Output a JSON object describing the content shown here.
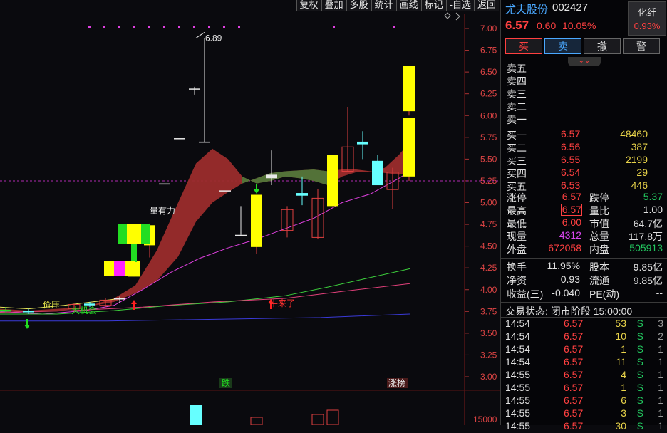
{
  "toolbar": [
    "复权",
    "叠加",
    "多股",
    "统计",
    "画线",
    "标记",
    "-自选",
    "返回"
  ],
  "stock": {
    "name": "尤夫股份",
    "code": "002427",
    "price": "6.57",
    "change": "0.60",
    "change_pct": "10.05%",
    "rz_label": "化纤",
    "rz_value": "0.93%"
  },
  "trade_buttons": [
    "买",
    "卖",
    "撤",
    "警"
  ],
  "expander": "⌄⌄",
  "order_book": {
    "asks": [
      {
        "label": "卖五",
        "price": "",
        "vol": ""
      },
      {
        "label": "卖四",
        "price": "",
        "vol": ""
      },
      {
        "label": "卖三",
        "price": "",
        "vol": ""
      },
      {
        "label": "卖二",
        "price": "",
        "vol": ""
      },
      {
        "label": "卖一",
        "price": "",
        "vol": ""
      }
    ],
    "bids": [
      {
        "label": "买一",
        "price": "6.57",
        "vol": "48460"
      },
      {
        "label": "买二",
        "price": "6.56",
        "vol": "387"
      },
      {
        "label": "买三",
        "price": "6.55",
        "vol": "2199"
      },
      {
        "label": "买四",
        "price": "6.54",
        "vol": "29"
      },
      {
        "label": "买五",
        "price": "6.53",
        "vol": "446"
      }
    ]
  },
  "stats": [
    {
      "l1": "涨停",
      "v1": "6.57",
      "c1": "#ff4040",
      "l2": "跌停",
      "v2": "5.37",
      "c2": "#22c55e"
    },
    {
      "l1": "最高",
      "v1": "6.57",
      "c1": "#ff4040",
      "l2": "量比",
      "v2": "1.00",
      "c2": "#e0e0e0"
    },
    {
      "l1": "最低",
      "v1": "6.00",
      "c1": "#ff4040",
      "l2": "市值",
      "v2": "64.7亿",
      "c2": "#e0e0e0"
    },
    {
      "l1": "现量",
      "v1": "4312",
      "c1": "#d946ef",
      "l2": "总量",
      "v2": "117.8万",
      "c2": "#e0e0e0"
    },
    {
      "l1": "外盘",
      "v1": "672058",
      "c1": "#ff4040",
      "l2": "内盘",
      "v2": "505913",
      "c2": "#22c55e"
    }
  ],
  "stats2": [
    {
      "l1": "换手",
      "v1": "11.95%",
      "l2": "股本",
      "v2": "9.85亿"
    },
    {
      "l1": "净资",
      "v1": "0.93",
      "l2": "流通",
      "v2": "9.85亿"
    },
    {
      "l1": "收益(三)",
      "v1": "-0.040",
      "l2": "PE(动)",
      "v2": "--"
    }
  ],
  "trade_status": "交易状态: 闭市阶段 15:00:00",
  "ticks": [
    {
      "time": "14:54",
      "price": "6.57",
      "vol": "53",
      "side": "S",
      "n": "3"
    },
    {
      "time": "14:54",
      "price": "6.57",
      "vol": "10",
      "side": "S",
      "n": "2"
    },
    {
      "time": "14:54",
      "price": "6.57",
      "vol": "1",
      "side": "S",
      "n": "1"
    },
    {
      "time": "14:54",
      "price": "6.57",
      "vol": "11",
      "side": "S",
      "n": "1"
    },
    {
      "time": "14:55",
      "price": "6.57",
      "vol": "4",
      "side": "S",
      "n": "1"
    },
    {
      "time": "14:55",
      "price": "6.57",
      "vol": "1",
      "side": "S",
      "n": "1"
    },
    {
      "time": "14:55",
      "price": "6.57",
      "vol": "6",
      "side": "S",
      "n": "1"
    },
    {
      "time": "14:55",
      "price": "6.57",
      "vol": "3",
      "side": "S",
      "n": "1"
    },
    {
      "time": "14:55",
      "price": "6.57",
      "vol": "30",
      "side": "S",
      "n": "1"
    }
  ],
  "chart_data": {
    "type": "candlestick",
    "y_ticks": [
      "7.00",
      "6.75",
      "6.50",
      "6.25",
      "6.00",
      "5.75",
      "5.50",
      "5.25",
      "5.00",
      "4.75",
      "4.50",
      "4.25",
      "4.00",
      "3.75",
      "3.50",
      "3.25",
      "3.00"
    ],
    "y_tick_values": [
      7.0,
      6.75,
      6.5,
      6.25,
      6.0,
      5.75,
      5.5,
      5.25,
      5.0,
      4.75,
      4.5,
      4.25,
      4.0,
      3.75,
      3.5,
      3.25,
      3.0
    ],
    "ylim": [
      2.95,
      7.1
    ],
    "reference_price": 5.25,
    "high_label": "6.89",
    "candles": [
      {
        "o": 3.77,
        "h": 3.8,
        "l": 3.74,
        "c": 3.75,
        "kind": "green"
      },
      {
        "o": 3.76,
        "h": 3.78,
        "l": 3.72,
        "c": 3.74,
        "kind": "cyan"
      },
      {
        "o": 3.78,
        "h": 3.84,
        "l": 3.75,
        "c": 3.83,
        "kind": "outline"
      },
      {
        "o": 3.84,
        "h": 3.86,
        "l": 3.8,
        "c": 3.82,
        "kind": "cyan"
      },
      {
        "o": 3.82,
        "h": 3.9,
        "l": 3.8,
        "c": 3.88,
        "kind": "outline"
      },
      {
        "o": 3.89,
        "h": 3.92,
        "l": 3.85,
        "c": 3.9,
        "kind": "doji"
      },
      {
        "o": 4.15,
        "h": 4.33,
        "l": 4.15,
        "c": 4.33,
        "kind": "limit-up"
      },
      {
        "o": 4.51,
        "h": 4.76,
        "l": 4.37,
        "c": 4.74,
        "kind": "limit-up"
      },
      {
        "o": 5.22,
        "h": 5.22,
        "l": 5.22,
        "c": 5.22,
        "kind": "limit-line"
      },
      {
        "o": 5.74,
        "h": 5.74,
        "l": 5.74,
        "c": 5.74,
        "kind": "limit-line"
      },
      {
        "o": 6.31,
        "h": 6.33,
        "l": 6.24,
        "c": 6.31,
        "kind": "limit-line"
      },
      {
        "o": 5.69,
        "h": 6.89,
        "l": 5.69,
        "c": 5.7,
        "kind": "doji"
      },
      {
        "o": 5.14,
        "h": 5.14,
        "l": 5.14,
        "c": 5.14,
        "kind": "limit-line"
      },
      {
        "o": 4.63,
        "h": 4.96,
        "l": 4.63,
        "c": 4.63,
        "kind": "doji"
      },
      {
        "o": 4.49,
        "h": 5.09,
        "l": 4.41,
        "c": 5.09,
        "kind": "limit-up"
      },
      {
        "o": 5.28,
        "h": 5.6,
        "l": 5.2,
        "c": 5.32,
        "kind": "doji"
      },
      {
        "o": 4.68,
        "h": 4.96,
        "l": 4.6,
        "c": 4.92,
        "kind": "outline"
      },
      {
        "o": 5.11,
        "h": 5.3,
        "l": 4.97,
        "c": 5.08,
        "kind": "cyan"
      },
      {
        "o": 4.6,
        "h": 5.16,
        "l": 4.58,
        "c": 5.05,
        "kind": "outline"
      },
      {
        "o": 4.96,
        "h": 5.55,
        "l": 4.96,
        "c": 5.55,
        "kind": "limit-up"
      },
      {
        "o": 5.36,
        "h": 6.1,
        "l": 5.36,
        "c": 5.64,
        "kind": "outline"
      },
      {
        "o": 5.7,
        "h": 5.82,
        "l": 5.5,
        "c": 5.67,
        "kind": "cyan"
      },
      {
        "o": 5.48,
        "h": 5.55,
        "l": 5.2,
        "c": 5.2,
        "kind": "cyan"
      },
      {
        "o": 5.15,
        "h": 5.4,
        "l": 4.93,
        "c": 5.35,
        "kind": "outline"
      },
      {
        "o": 5.3,
        "h": 5.97,
        "l": 5.25,
        "c": 5.97,
        "kind": "limit-up"
      },
      {
        "o": 6.05,
        "h": 6.57,
        "l": 6.0,
        "c": 6.57,
        "kind": "limit-up"
      }
    ],
    "annotations": [
      "价压",
      "大机会",
      "量有力",
      "牛来了",
      "跌",
      "涨榜"
    ],
    "volume_ticks": [
      "15000"
    ]
  }
}
